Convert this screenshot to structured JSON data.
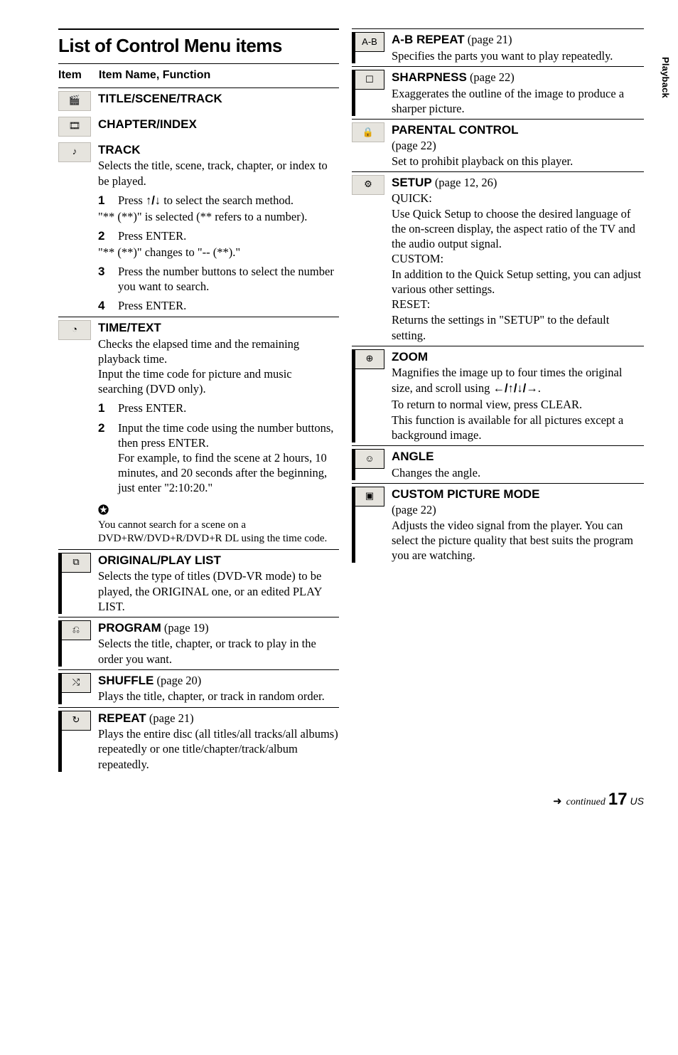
{
  "left": {
    "heading": "List of Control Menu items",
    "header_item": "Item",
    "header_name": "Item Name, Function",
    "e1": {
      "title": "TITLE/SCENE/TRACK"
    },
    "e2": {
      "title": "CHAPTER/INDEX"
    },
    "e3": {
      "title": "TRACK",
      "desc": "Selects the title, scene, track, chapter, or index to be played.",
      "s1": "Press X/x to select the search method.",
      "s1b": "\"** (**)\" is selected (** refers to a number).",
      "s2": "Press ENTER.",
      "s2b": "\"** (**)\" changes to \"-- (**).\"",
      "s3": "Press the number buttons to select the number you want to search.",
      "s4": "Press ENTER."
    },
    "e4": {
      "title": "TIME/TEXT",
      "desc": "Checks the elapsed time and the remaining playback time.\nInput the time code for picture and music searching (DVD only).",
      "s1": "Press ENTER.",
      "s2": "Input the time code using the number buttons, then press ENTER.",
      "s2b": "For example, to find the scene at 2 hours, 10 minutes, and 20 seconds after the beginning, just enter \"2:10:20.\"",
      "note_icon": "✪",
      "note": "You cannot search for a scene on a DVD+RW/DVD+R/DVD+R DL using the time code."
    },
    "e5": {
      "title": "ORIGINAL/PLAY LIST",
      "desc": "Selects the type of titles (DVD-VR mode) to be played, the ORIGINAL one, or an edited PLAY LIST."
    },
    "e6": {
      "title": "PROGRAM",
      "pg": " (page 19)",
      "desc": "Selects the title, chapter, or track to play in the order you want."
    },
    "e7": {
      "title": "SHUFFLE",
      "pg": " (page 20)",
      "desc": "Plays the title, chapter, or track in random order."
    },
    "e8": {
      "title": "REPEAT",
      "pg": " (page 21)",
      "desc": "Plays the entire disc (all titles/all tracks/all albums) repeatedly or one title/chapter/track/album repeatedly."
    }
  },
  "right": {
    "r1": {
      "title": "A-B REPEAT",
      "pg": " (page 21)",
      "desc": "Specifies the parts you want to play repeatedly."
    },
    "r2": {
      "title": "SHARPNESS",
      "pg": " (page 22)",
      "desc": "Exaggerates the outline of the image to produce a sharper picture."
    },
    "r3": {
      "title": "PARENTAL CONTROL",
      "pg": "(page 22)",
      "desc": "Set to prohibit playback on this player."
    },
    "r4": {
      "title": "SETUP",
      "pg": " (page 12, 26)",
      "q_h": "QUICK:",
      "q": "Use Quick Setup to choose the desired language of the on-screen display, the aspect ratio of the TV and the audio output signal.",
      "c_h": "CUSTOM:",
      "c": "In addition to the Quick Setup setting, you can adjust various other settings.",
      "r_h": "RESET:",
      "r": "Returns the settings in \"SETUP\" to the default setting."
    },
    "r5": {
      "title": "ZOOM",
      "desc1": "Magnifies the image up to four times the original size, and scroll using ",
      "arrows": "C/X/x/c",
      "desc2": ".",
      "desc3": "To return to normal view, press CLEAR.",
      "desc4": "This function is available for all pictures except a background image."
    },
    "r6": {
      "title": "ANGLE",
      "desc": "Changes the angle."
    },
    "r7": {
      "title": "CUSTOM PICTURE MODE",
      "pg": "(page 22)",
      "desc": "Adjusts the video signal from the player. You can select the picture quality that best suits the program you are watching."
    }
  },
  "side": "Playback",
  "footer": {
    "cont": "continued",
    "page": "17",
    "locale": "US"
  },
  "icons": {
    "note": "♪",
    "clock": "◔",
    "list": "⧉",
    "prog": "⎌",
    "shuf": "⤭",
    "rep": "↻",
    "ab": "A-B",
    "sharp": "☐",
    "lock": "🔒",
    "setup": "⚙",
    "zoom": "⊕",
    "angle": "☺",
    "pic": "▣",
    "film": "🎞",
    "clap": "🎬"
  }
}
